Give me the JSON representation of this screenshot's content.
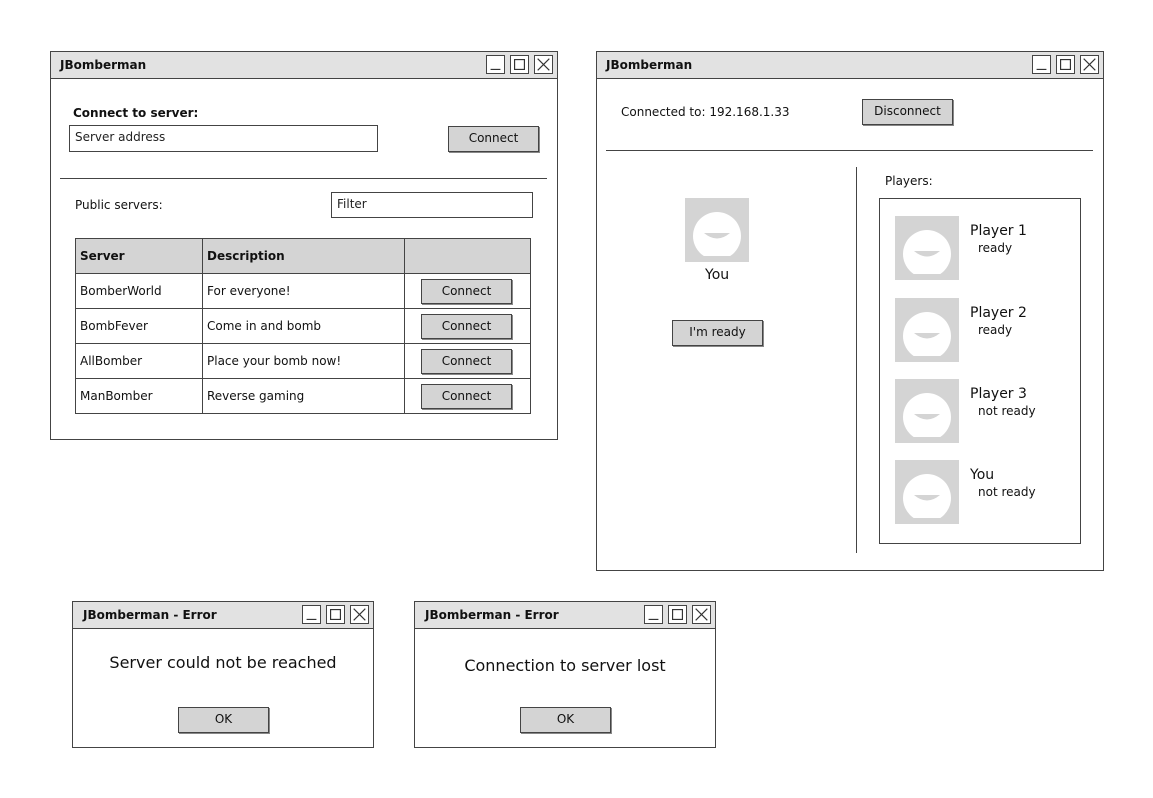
{
  "window_connect": {
    "title": "JBomberman",
    "connect_label": "Connect to server:",
    "server_address_placeholder": "Server address",
    "connect_button": "Connect",
    "public_servers_label": "Public servers:",
    "filter_placeholder": "Filter",
    "table": {
      "headers": [
        "Server",
        "Description",
        ""
      ],
      "rows": [
        {
          "server": "BomberWorld",
          "description": "For everyone!",
          "action": "Connect"
        },
        {
          "server": "BombFever",
          "description": "Come in and bomb",
          "action": "Connect"
        },
        {
          "server": "AllBomber",
          "description": "Place your bomb now!",
          "action": "Connect"
        },
        {
          "server": "ManBomber",
          "description": "Reverse gaming",
          "action": "Connect"
        }
      ]
    }
  },
  "window_lobby": {
    "title": "JBomberman",
    "connected_to": "Connected to: 192.168.1.33",
    "disconnect_button": "Disconnect",
    "self_label": "You",
    "ready_button": "I'm ready",
    "players_label": "Players:",
    "players": [
      {
        "name": "Player 1",
        "status": "ready"
      },
      {
        "name": "Player 2",
        "status": "ready"
      },
      {
        "name": "Player 3",
        "status": "not ready"
      },
      {
        "name": "You",
        "status": "not ready"
      }
    ]
  },
  "error_unreachable": {
    "title": "JBomberman - Error",
    "message": "Server could not be reached",
    "ok_button": "OK"
  },
  "error_lost": {
    "title": "JBomberman - Error",
    "message": "Connection to server lost",
    "ok_button": "OK"
  },
  "icons": {
    "minimize": "minimize-icon",
    "maximize": "maximize-icon",
    "close": "close-icon",
    "avatar": "user-avatar-icon"
  },
  "colors": {
    "titlebar": "#e2e2e2",
    "button": "#d4d4d4",
    "border": "#444444"
  }
}
